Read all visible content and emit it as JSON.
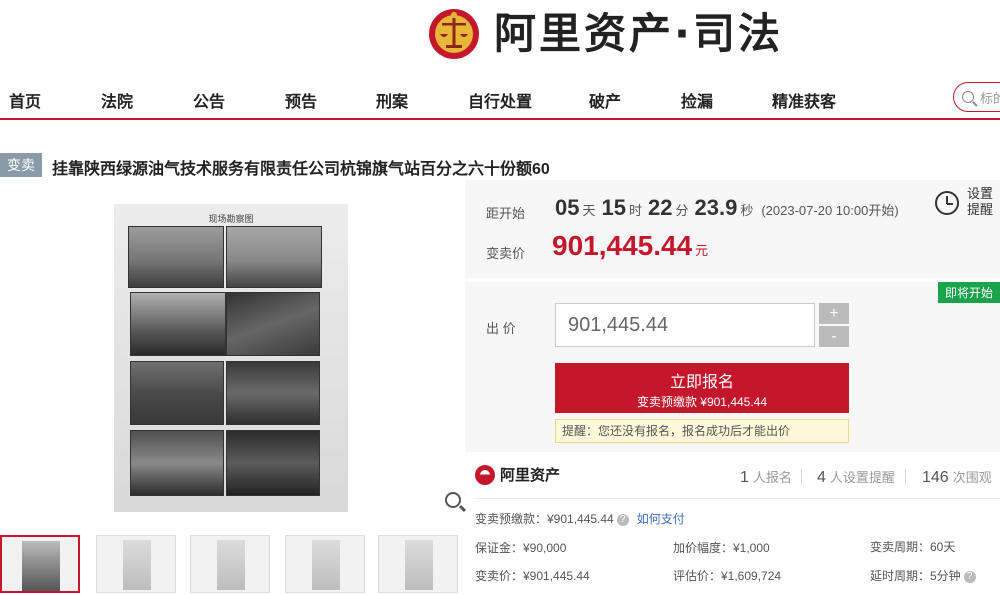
{
  "header": {
    "logo_text": "阿里资产·司法"
  },
  "nav": {
    "items": [
      "首页",
      "法院",
      "公告",
      "预告",
      "刑案",
      "自行处置",
      "破产",
      "捡漏",
      "精准获客"
    ],
    "search_placeholder": "标的"
  },
  "item": {
    "badge": "变卖",
    "title": "挂靠陕西绿源油气技术服务有限责任公司杭锦旗气站百分之六十份额60",
    "image_caption": "现场勘察图"
  },
  "countdown": {
    "label": "距开始",
    "days": "05",
    "days_unit": "天",
    "hours": "15",
    "hours_unit": "时",
    "minutes": "22",
    "minutes_unit": "分",
    "seconds": "23.9",
    "seconds_unit": "秒",
    "start_note": "(2023-07-20 10:00开始)"
  },
  "remind": {
    "line1": "设置",
    "line2": "提醒"
  },
  "price": {
    "label": "变卖价",
    "value": "901,445.44",
    "unit": "元"
  },
  "bid": {
    "status_badge": "即将开始",
    "label": "出 价",
    "input_value": "901,445.44",
    "plus": "+",
    "minus": "-",
    "signup_label": "立即报名",
    "signup_sub": "变卖预缴款 ¥901,445.44",
    "tip": "提醒：您还没有报名，报名成功后才能出价"
  },
  "info": {
    "brand": "阿里资产",
    "stats": [
      {
        "num": "1",
        "label": "人报名"
      },
      {
        "num": "4",
        "label": "人设置提醒"
      },
      {
        "num": "146",
        "label": "次围观"
      }
    ],
    "deposit": "变卖预缴款：¥901,445.44",
    "deposit_q": "?",
    "how_to_pay": "如何支付",
    "margin": "保证金：¥90,000",
    "increment": "加价幅度：¥1,000",
    "period": "变卖周期：60天",
    "sale_price": "变卖价：¥901,445.44",
    "appraisal": "评估价：¥1,609,724",
    "delay": "延时周期：5分钟",
    "delay_q": "?"
  },
  "colors": {
    "brand_red": "#c5172c",
    "green": "#1aa34a",
    "badge_grey": "#8a9aa8"
  }
}
